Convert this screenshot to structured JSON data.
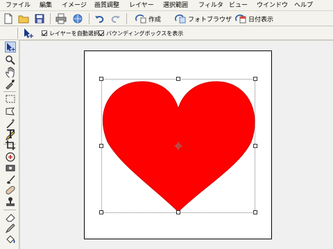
{
  "menu": [
    "ファイル",
    "編集",
    "イメージ",
    "画質調整",
    "レイヤー",
    "選択範囲",
    "フィルタ",
    "ビュー",
    "ウインドウ",
    "ヘルプ"
  ],
  "toolbar": {
    "create_label": "作成",
    "browser_label": "フォトブラウザ",
    "date_label": "日付表示"
  },
  "options": {
    "auto_select_label": "レイヤーを自動選択",
    "bounding_box_label": "バウンディングボックスを表示",
    "auto_select_checked": true,
    "bounding_box_checked": true
  },
  "colors": {
    "heart_fill": "#ff0000",
    "accent": "#6f8fc8"
  },
  "tools": [
    "move-icon",
    "zoom-icon",
    "hand-icon",
    "eyedropper-icon",
    "marquee-icon",
    "lasso-icon",
    "magic-wand-icon",
    "pencil-icon",
    "type-icon",
    "crop-icon",
    "shape-icon",
    "red-eye-icon",
    "brush-icon",
    "healing-icon",
    "stamp-icon",
    "eraser-icon",
    "pencil-tool-icon",
    "paint-bucket-icon"
  ]
}
